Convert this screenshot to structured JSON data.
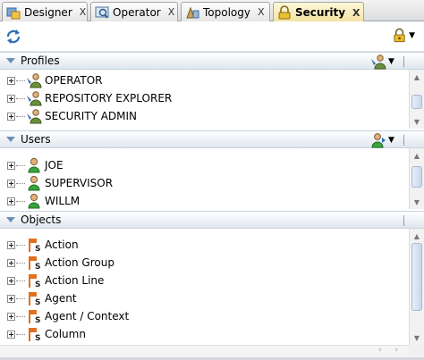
{
  "tabs": [
    {
      "label": "Designer",
      "close": "X",
      "icon": "designer-icon"
    },
    {
      "label": "Operator",
      "close": "X",
      "icon": "operator-icon"
    },
    {
      "label": "Topology",
      "close": "X",
      "icon": "topology-icon"
    },
    {
      "label": "Security",
      "close": "X",
      "icon": "security-icon",
      "active": true
    }
  ],
  "toolbar": {
    "refresh_icon": "refresh-icon",
    "security_menu_icon": "lock-user-icon"
  },
  "sections": {
    "profiles": {
      "title": "Profiles",
      "items": [
        "OPERATOR",
        "REPOSITORY EXPLORER",
        "SECURITY ADMIN"
      ],
      "item_icon": "profile-icon"
    },
    "users": {
      "title": "Users",
      "items": [
        "JOE",
        "SUPERVISOR",
        "WILLM"
      ],
      "item_icon": "user-icon"
    },
    "objects": {
      "title": "Objects",
      "items": [
        "Action",
        "Action Group",
        "Action Line",
        "Agent",
        "Agent / Context",
        "Column"
      ],
      "item_icon": "object-flag-icon"
    }
  },
  "colors": {
    "active_tab": "#f3e2a0",
    "section_header": "#dfe6ee",
    "scroll_thumb": "#c9d9ee",
    "user_green": "#3aa53a",
    "object_orange": "#e07020"
  }
}
